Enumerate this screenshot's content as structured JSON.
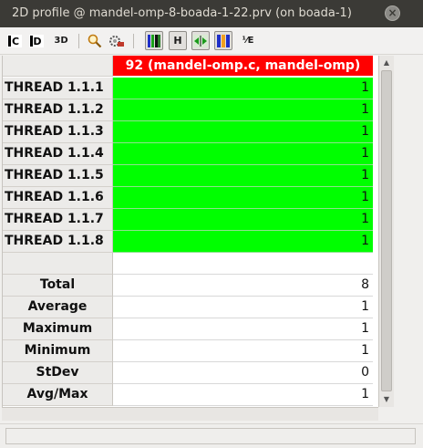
{
  "window": {
    "title": "2D profile @ mandel-omp-8-boada-1-22.prv (on boada-1)",
    "close_glyph": "×"
  },
  "toolbar": {
    "buttons": [
      {
        "icon": "open-control-window-icon",
        "glyph": "C",
        "pressed": false
      },
      {
        "icon": "open-data-window-icon",
        "glyph": "D",
        "pressed": false
      },
      {
        "icon": "3d-view-icon",
        "glyph": "3D",
        "pressed": false
      },
      {
        "icon": "zoom-magnifier-icon",
        "glyph": "🔍",
        "pressed": false
      },
      {
        "icon": "settings-icon",
        "glyph": "✺",
        "pressed": false
      },
      {
        "icon": "color-mode-icon",
        "glyph": "▌▌▌",
        "pressed": true
      },
      {
        "icon": "hide-empty-columns-icon",
        "glyph": "H",
        "pressed": true
      },
      {
        "icon": "fit-columns-icon",
        "glyph": "↔",
        "pressed": true
      },
      {
        "icon": "gradient-mode-icon",
        "glyph": "▌▌",
        "pressed": true
      },
      {
        "icon": "fraction-icon",
        "glyph": "⅟"
      }
    ]
  },
  "table": {
    "column_header": "92 (mandel-omp.c, mandel-omp)",
    "threads": [
      {
        "label": "THREAD 1.1.1",
        "value": "1"
      },
      {
        "label": "THREAD 1.1.2",
        "value": "1"
      },
      {
        "label": "THREAD 1.1.3",
        "value": "1"
      },
      {
        "label": "THREAD 1.1.4",
        "value": "1"
      },
      {
        "label": "THREAD 1.1.5",
        "value": "1"
      },
      {
        "label": "THREAD 1.1.6",
        "value": "1"
      },
      {
        "label": "THREAD 1.1.7",
        "value": "1"
      },
      {
        "label": "THREAD 1.1.8",
        "value": "1"
      }
    ],
    "stats": [
      {
        "label": "Total",
        "value": "8"
      },
      {
        "label": "Average",
        "value": "1"
      },
      {
        "label": "Maximum",
        "value": "1"
      },
      {
        "label": "Minimum",
        "value": "1"
      },
      {
        "label": "StDev",
        "value": "0"
      },
      {
        "label": "Avg/Max",
        "value": "1"
      }
    ]
  },
  "colors": {
    "header_red": "#ff0000",
    "cell_green": "#00ff00",
    "titlebar": "#3b3a36"
  }
}
